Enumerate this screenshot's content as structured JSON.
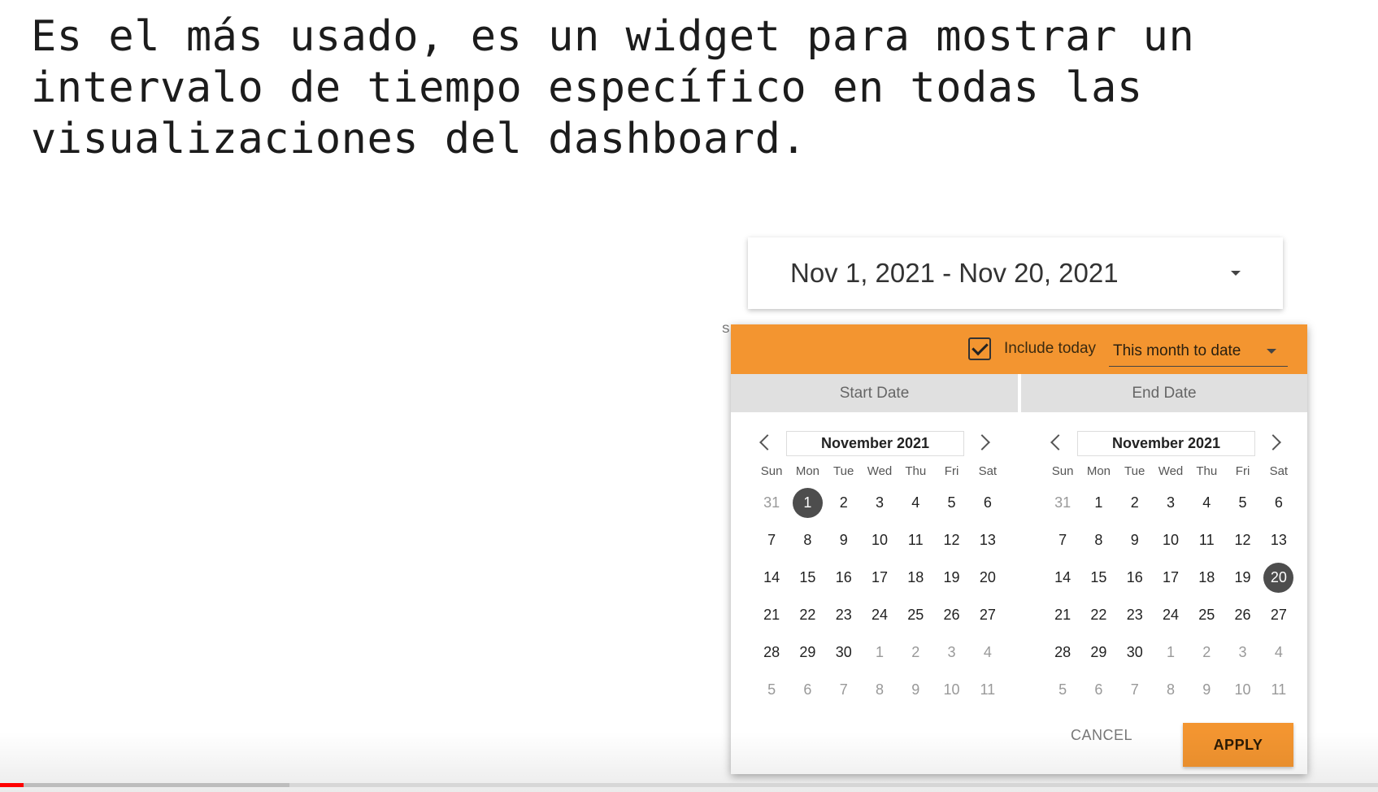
{
  "headline": "Es el más usado, es un widget para mostrar un\nintervalo de tiempo específico en todas las\nvisualizaciones del dashboard.",
  "date_range": {
    "value": "Nov 1, 2021 - Nov 20, 2021",
    "icon": "caret-down-icon"
  },
  "popup": {
    "include_today_label": "Include today",
    "include_today_checked": true,
    "preset_value": "This month to date",
    "start_tab": "Start Date",
    "end_tab": "End Date",
    "cancel_label": "CANCEL",
    "apply_label": "APPLY",
    "accent_color": "#f39530"
  },
  "days_of_week": [
    "Sun",
    "Mon",
    "Tue",
    "Wed",
    "Thu",
    "Fri",
    "Sat"
  ],
  "start_calendar": {
    "month_label": "November 2021",
    "selected_day": 1,
    "weeks": [
      [
        "31",
        "1",
        "2",
        "3",
        "4",
        "5",
        "6"
      ],
      [
        "7",
        "8",
        "9",
        "10",
        "11",
        "12",
        "13"
      ],
      [
        "14",
        "15",
        "16",
        "17",
        "18",
        "19",
        "20"
      ],
      [
        "21",
        "22",
        "23",
        "24",
        "25",
        "26",
        "27"
      ],
      [
        "28",
        "29",
        "30",
        "1",
        "2",
        "3",
        "4"
      ],
      [
        "5",
        "6",
        "7",
        "8",
        "9",
        "10",
        "11"
      ]
    ]
  },
  "end_calendar": {
    "month_label": "November 2021",
    "selected_day": 20,
    "weeks": [
      [
        "31",
        "1",
        "2",
        "3",
        "4",
        "5",
        "6"
      ],
      [
        "7",
        "8",
        "9",
        "10",
        "11",
        "12",
        "13"
      ],
      [
        "14",
        "15",
        "16",
        "17",
        "18",
        "19",
        "20"
      ],
      [
        "21",
        "22",
        "23",
        "24",
        "25",
        "26",
        "27"
      ],
      [
        "28",
        "29",
        "30",
        "1",
        "2",
        "3",
        "4"
      ],
      [
        "5",
        "6",
        "7",
        "8",
        "9",
        "10",
        "11"
      ]
    ]
  },
  "video_progress": {
    "played_fraction": 0.017,
    "buffered_fraction": 0.21
  }
}
